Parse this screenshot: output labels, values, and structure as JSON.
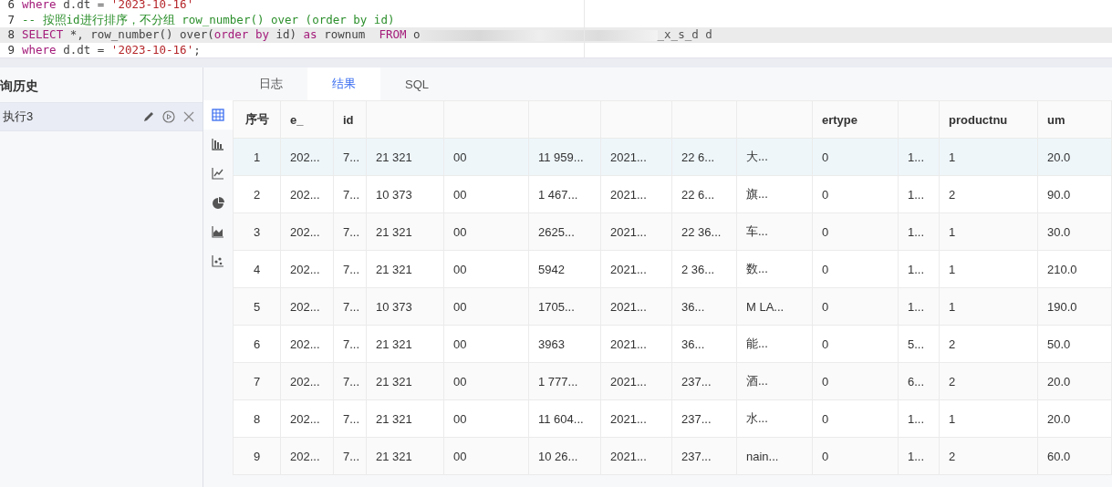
{
  "editor": {
    "lines": [
      {
        "number": "6",
        "highlighted": false,
        "tokens": [
          {
            "kind": "keyword",
            "text": "where"
          },
          {
            "kind": "plain",
            "text": " d.dt = "
          },
          {
            "kind": "string",
            "text": "'2023-10-16'"
          }
        ]
      },
      {
        "number": "7",
        "highlighted": false,
        "tokens": [
          {
            "kind": "comment",
            "text": "-- 按照id进行排序，不分组 row_number() over (order by id)"
          }
        ]
      },
      {
        "number": "8",
        "highlighted": true,
        "tokens": [
          {
            "kind": "keyword",
            "text": "SELECT"
          },
          {
            "kind": "plain",
            "text": " *, row_number() over("
          },
          {
            "kind": "keyword",
            "text": "order by"
          },
          {
            "kind": "plain",
            "text": " id) "
          },
          {
            "kind": "keyword",
            "text": "as"
          },
          {
            "kind": "plain",
            "text": " rownum  "
          },
          {
            "kind": "keyword",
            "text": "FROM"
          },
          {
            "kind": "plain",
            "text": " o"
          },
          {
            "kind": "blur",
            "text": "_x_s_d d"
          }
        ]
      },
      {
        "number": "9",
        "highlighted": false,
        "tokens": [
          {
            "kind": "keyword",
            "text": "where"
          },
          {
            "kind": "plain",
            "text": " d.dt = "
          },
          {
            "kind": "string",
            "text": "'2023-10-16'"
          },
          {
            "kind": "plain",
            "text": ";"
          }
        ]
      }
    ]
  },
  "history": {
    "title": "询历史",
    "items": [
      {
        "label": "执行3",
        "selected": true
      }
    ]
  },
  "result_tabs": [
    {
      "label": "日志",
      "selected": false
    },
    {
      "label": "结果",
      "selected": true
    },
    {
      "label": "SQL",
      "selected": false
    }
  ],
  "view_icons": [
    {
      "kind": "table",
      "selected": true
    },
    {
      "kind": "bar",
      "selected": false
    },
    {
      "kind": "line",
      "selected": false
    },
    {
      "kind": "pie",
      "selected": false
    },
    {
      "kind": "area",
      "selected": false
    },
    {
      "kind": "scatter",
      "selected": false
    }
  ],
  "table": {
    "columns": [
      {
        "label": "序号"
      },
      {
        "label": "e_"
      },
      {
        "label": "id"
      },
      {},
      {},
      {},
      {},
      {},
      {},
      {
        "label": "ertype"
      },
      {},
      {
        "label": "productnu"
      },
      {
        "label": "um"
      }
    ],
    "rows": [
      {
        "selected": true,
        "cells": [
          "1",
          "202...",
          "7...",
          "21 321",
          "00",
          "11 959...",
          "2021...",
          "22 6...",
          "大...",
          "0",
          "1...",
          "1",
          "20.0"
        ]
      },
      {
        "selected": false,
        "cells": [
          "2",
          "202...",
          "7...",
          "10 373",
          "00",
          "1 467...",
          "2021...",
          "22 6...",
          "旗...",
          "0",
          "1...",
          "2",
          "90.0"
        ]
      },
      {
        "selected": false,
        "cells": [
          "3",
          "202...",
          "7...",
          "21 321",
          "00",
          "2625...",
          "2021...",
          "22 36...",
          "车...",
          "0",
          "1...",
          "1",
          "30.0"
        ]
      },
      {
        "selected": false,
        "cells": [
          "4",
          "202...",
          "7...",
          "21 321",
          "00",
          "5942",
          "2021...",
          "2 36...",
          "数...",
          "0",
          "1...",
          "1",
          "210.0"
        ]
      },
      {
        "selected": false,
        "cells": [
          "5",
          "202...",
          "7...",
          "10 373",
          "00",
          "1705...",
          "2021...",
          "36...",
          "M LA...",
          "0",
          "1...",
          "1",
          "190.0"
        ]
      },
      {
        "selected": false,
        "cells": [
          "6",
          "202...",
          "7...",
          "21 321",
          "00",
          "3963",
          "2021...",
          "36...",
          "能...",
          "0",
          "5...",
          "2",
          "50.0"
        ]
      },
      {
        "selected": false,
        "cells": [
          "7",
          "202...",
          "7...",
          "21 321",
          "00",
          "1 777...",
          "2021...",
          "237...",
          "酒...",
          "0",
          "6...",
          "2",
          "20.0"
        ]
      },
      {
        "selected": false,
        "cells": [
          "8",
          "202...",
          "7...",
          "21 321",
          "00",
          "11 604...",
          "2021...",
          "237...",
          "水...",
          "0",
          "1...",
          "1",
          "20.0"
        ]
      },
      {
        "selected": false,
        "cells": [
          "9",
          "202...",
          "7...",
          "21 321",
          "00",
          "10 26...",
          "2021...",
          "237...",
          "nain...",
          "0",
          "1...",
          "2",
          "60.0"
        ]
      }
    ]
  }
}
